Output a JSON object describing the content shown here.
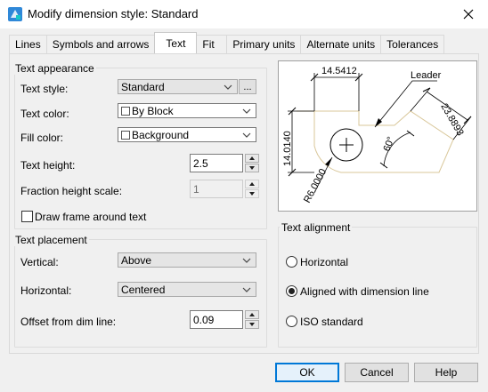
{
  "window": {
    "title": "Modify dimension style: Standard",
    "app_icon": "cad-app-icon",
    "close_icon": "close-icon"
  },
  "tabs": [
    {
      "label": "Lines",
      "active": false
    },
    {
      "label": "Symbols and arrows",
      "active": false
    },
    {
      "label": "Text",
      "active": true
    },
    {
      "label": "Fit",
      "active": false
    },
    {
      "label": "Primary units",
      "active": false
    },
    {
      "label": "Alternate units",
      "active": false
    },
    {
      "label": "Tolerances",
      "active": false
    }
  ],
  "text_appearance": {
    "title": "Text appearance",
    "text_style": {
      "label": "Text style:",
      "value": "Standard",
      "browse_label": "..."
    },
    "text_color": {
      "label": "Text color:",
      "value": "By Block",
      "swatch": "#ffffff"
    },
    "fill_color": {
      "label": "Fill color:",
      "value": "Background",
      "swatch": "#ffffff"
    },
    "text_height": {
      "label": "Text height:",
      "value": "2.5"
    },
    "fraction_height_scale": {
      "label": "Fraction height scale:",
      "value": "1",
      "enabled": false
    },
    "draw_frame": {
      "label": "Draw frame around text",
      "checked": false
    }
  },
  "text_placement": {
    "title": "Text placement",
    "vertical": {
      "label": "Vertical:",
      "value": "Above"
    },
    "horizontal": {
      "label": "Horizontal:",
      "value": "Centered"
    },
    "offset": {
      "label": "Offset from dim line:",
      "value": "0.09"
    }
  },
  "preview": {
    "dim_top": "14.5412",
    "dim_left": "14.0140",
    "dim_right": "23.8893",
    "dim_angle": "60°",
    "dim_radius": "R6.0000",
    "leader": "Leader"
  },
  "text_alignment": {
    "title": "Text alignment",
    "options": [
      {
        "label": "Horizontal",
        "checked": false
      },
      {
        "label": "Aligned with dimension line",
        "checked": true
      },
      {
        "label": "ISO standard",
        "checked": false
      }
    ]
  },
  "buttons": {
    "ok": "OK",
    "cancel": "Cancel",
    "help": "Help"
  },
  "colors": {
    "accent": "#0078d7",
    "preview_outline": "#d9c79a",
    "panel": "#f0f0f0"
  }
}
